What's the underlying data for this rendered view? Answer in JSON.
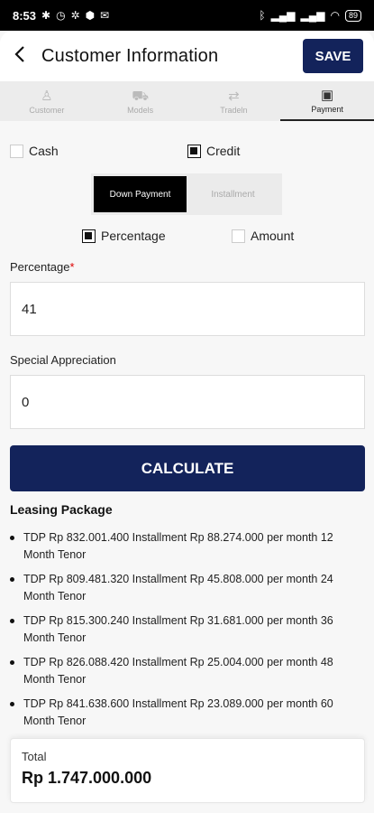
{
  "status_bar": {
    "time": "8:53",
    "left_icons": [
      "gear-icon",
      "alarm-icon",
      "settings-icon",
      "shield-icon",
      "mail-icon"
    ],
    "right_icons": [
      "bluetooth-icon",
      "signal-icon",
      "signal-icon",
      "wifi-icon"
    ],
    "battery": "89"
  },
  "header": {
    "back_icon": "back-arrow-icon",
    "title": "Customer Information",
    "save_label": "SAVE"
  },
  "tabs": [
    {
      "label": "Customer",
      "icon": "person-icon"
    },
    {
      "label": "Models",
      "icon": "car-icon"
    },
    {
      "label": "Tradeln",
      "icon": "swap-icon"
    },
    {
      "label": "Payment",
      "icon": "payment-icon",
      "active": true
    }
  ],
  "payment_type": {
    "cash_label": "Cash",
    "credit_label": "Credit",
    "selected": "Credit"
  },
  "segment": {
    "down_payment_label": "Down Payment",
    "installment_label": "Installment",
    "selected": "Down Payment"
  },
  "dp_mode": {
    "percentage_label": "Percentage",
    "amount_label": "Amount",
    "selected": "Percentage"
  },
  "percentage": {
    "label": "Percentage",
    "required_mark": "*",
    "value": "41"
  },
  "special_appreciation": {
    "label": "Special Appreciation",
    "value": "0"
  },
  "calculate_label": "CALCULATE",
  "leasing": {
    "title": "Leasing Package",
    "items": [
      "TDP Rp 832.001.400 Installment Rp 88.274.000 per month 12 Month Tenor",
      "TDP Rp 809.481.320 Installment Rp 45.808.000 per month 24 Month Tenor",
      "TDP Rp 815.300.240 Installment Rp 31.681.000 per month 36 Month Tenor",
      "TDP Rp 826.088.420 Installment Rp 25.004.000 per month 48 Month Tenor",
      "TDP Rp 841.638.600 Installment Rp 23.089.000 per month 60 Month Tenor"
    ]
  },
  "total": {
    "label": "Total",
    "value": "Rp 1.747.000.000"
  },
  "colors": {
    "primary": "#13235b",
    "background": "#f7f7f7"
  }
}
